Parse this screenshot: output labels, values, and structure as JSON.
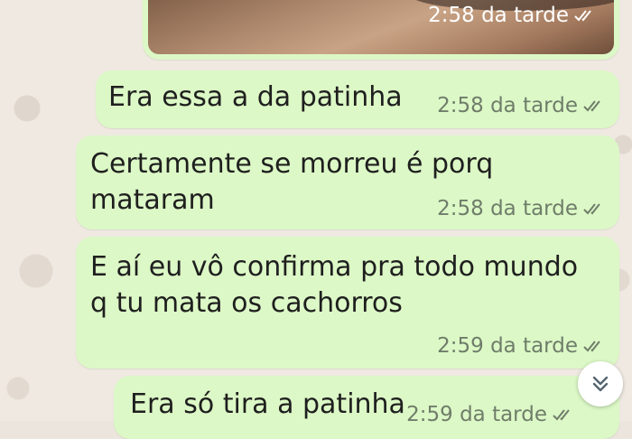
{
  "messages": [
    {
      "type": "image",
      "time": "2:58 da tarde"
    },
    {
      "type": "text",
      "text": "Era essa a da patinha",
      "time": "2:58 da tarde"
    },
    {
      "type": "text",
      "text": "Certamente se morreu é porq\nmataram",
      "time": "2:58 da tarde"
    },
    {
      "type": "text",
      "text": "E aí eu vô confirma pra todo mundo\nq tu mata os cachorros",
      "time": "2:59 da tarde"
    },
    {
      "type": "text",
      "text": "Era só tira a patinha",
      "time": "2:59 da tarde"
    }
  ],
  "icons": {
    "ticks": "double-check-icon",
    "scroll": "chevron-double-down-icon"
  },
  "colors": {
    "bubble": "#dcf8c6",
    "ticks": "#6f7d6a",
    "wallpaper": "#efe9e1"
  }
}
